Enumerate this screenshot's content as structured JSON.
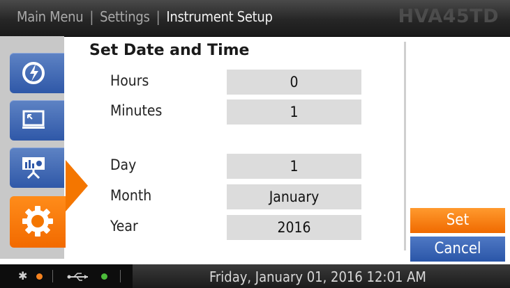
{
  "header": {
    "breadcrumb": [
      "Main Menu",
      "Settings",
      "Instrument Setup"
    ],
    "separator": "|",
    "model": "HVA45TD"
  },
  "sidebar": {
    "items": [
      {
        "icon": "power-test-icon",
        "active": false
      },
      {
        "icon": "display-icon",
        "active": false
      },
      {
        "icon": "presentation-chart-icon",
        "active": false
      },
      {
        "icon": "gear-icon",
        "active": true
      }
    ]
  },
  "form": {
    "title": "Set Date and Time",
    "fields": {
      "hours": {
        "label": "Hours",
        "value": "0"
      },
      "minutes": {
        "label": "Minutes",
        "value": "1"
      },
      "day": {
        "label": "Day",
        "value": "1"
      },
      "month": {
        "label": "Month",
        "value": "January"
      },
      "year": {
        "label": "Year",
        "value": "2016"
      }
    }
  },
  "buttons": {
    "set": "Set",
    "cancel": "Cancel"
  },
  "statusbar": {
    "datetime": "Friday, January 01, 2016 12:01 AM",
    "bluetooth_glyph": "✱",
    "usb_glyph": "⭠",
    "bluetooth_dot_color": "#f5821f",
    "usb_dot_color": "#4cbb3a"
  },
  "colors": {
    "accent": "#f47600",
    "primary": "#2f58a8"
  }
}
